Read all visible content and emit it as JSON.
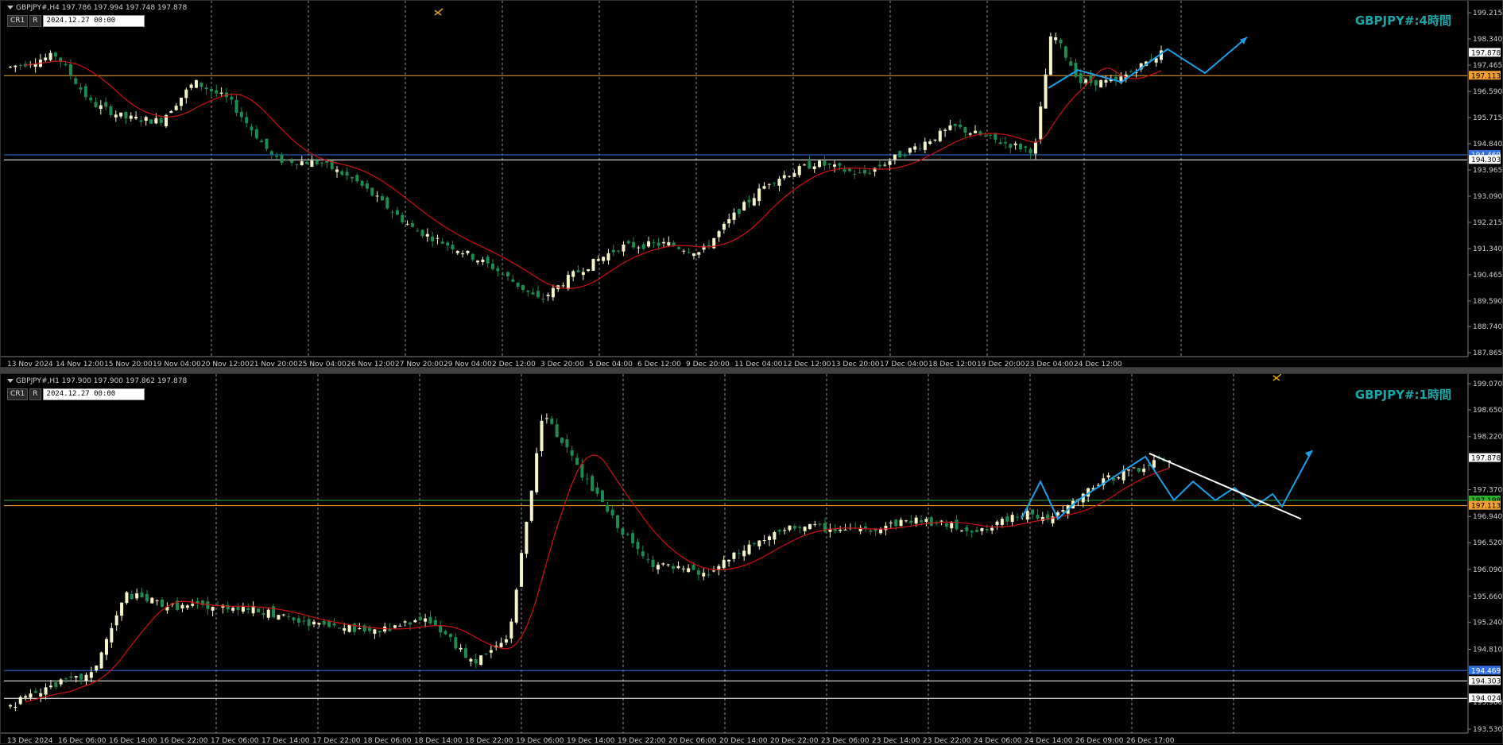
{
  "colors": {
    "background": "#000000",
    "bull": "#f5f5c8",
    "bear": "#1e8c50",
    "ma": "#d01010",
    "grid": "#909090",
    "title": "#1aa6a6",
    "projection": "#19a0e6",
    "trendline": "#ffffff",
    "orange_line": "#f0a030",
    "blue_line": "#3070e0",
    "green_line": "#30b030",
    "white_line": "#ffffff"
  },
  "pane_h4": {
    "header_text": "GBPJPY#,H4  197.786 197.994 197.748 197.878",
    "tb_cr": "CR1",
    "tb_r": "R",
    "date_box": "2024.12.27 00:00",
    "title": "GBPJPY#:4時間",
    "price_labels": [
      {
        "text": "199.215",
        "v": 199.215
      },
      {
        "text": "198.340",
        "v": 198.34
      },
      {
        "text": "197.465",
        "v": 197.465
      },
      {
        "text": "196.590",
        "v": 196.59
      },
      {
        "text": "195.715",
        "v": 195.715
      },
      {
        "text": "194.840",
        "v": 194.84
      },
      {
        "text": "193.965",
        "v": 193.965
      },
      {
        "text": "193.090",
        "v": 193.09
      },
      {
        "text": "192.215",
        "v": 192.215
      },
      {
        "text": "191.340",
        "v": 191.34
      },
      {
        "text": "190.465",
        "v": 190.465
      },
      {
        "text": "189.590",
        "v": 189.59
      },
      {
        "text": "188.740",
        "v": 188.74
      },
      {
        "text": "187.865",
        "v": 187.865
      }
    ],
    "special_labels": [
      {
        "text": "197.878",
        "v": 197.878,
        "bg": "#ffffff",
        "fg": "#000000"
      },
      {
        "text": "197.113",
        "v": 197.113,
        "bg": "#f0a030",
        "fg": "#000000"
      },
      {
        "text": "194.469",
        "v": 194.469,
        "bg": "#3070e0",
        "fg": "#ffffff"
      },
      {
        "text": "194.303",
        "v": 194.303,
        "bg": "#ffffff",
        "fg": "#000000"
      }
    ],
    "time_labels": [
      "13 Nov 2024",
      "14 Nov 12:00",
      "15 Nov 20:00",
      "19 Nov 04:00",
      "20 Nov 12:00",
      "21 Nov 20:00",
      "25 Nov 04:00",
      "26 Nov 12:00",
      "27 Nov 20:00",
      "29 Nov 04:00",
      "2 Dec 12:00",
      "3 Dec 20:00",
      "5 Dec 04:00",
      "6 Dec 12:00",
      "9 Dec 20:00",
      "11 Dec 04:00",
      "12 Dec 12:00",
      "13 Dec 20:00",
      "17 Dec 04:00",
      "18 Dec 12:00",
      "19 Dec 20:00",
      "23 Dec 04:00",
      "24 Dec 12:00"
    ]
  },
  "pane_h1": {
    "header_text": "GBPJPY#,H1  197.900 197.900 197.862 197.878",
    "tb_cr": "CR1",
    "tb_r": "R",
    "date_box": "2024.12.27 00:00",
    "title": "GBPJPY#:1時間",
    "price_labels": [
      {
        "text": "199.070",
        "v": 199.07
      },
      {
        "text": "198.650",
        "v": 198.65
      },
      {
        "text": "198.220",
        "v": 198.22
      },
      {
        "text": "197.370",
        "v": 197.37
      },
      {
        "text": "196.940",
        "v": 196.94
      },
      {
        "text": "196.520",
        "v": 196.52
      },
      {
        "text": "196.090",
        "v": 196.09
      },
      {
        "text": "195.660",
        "v": 195.66
      },
      {
        "text": "195.240",
        "v": 195.24
      },
      {
        "text": "194.810",
        "v": 194.81
      },
      {
        "text": "193.960",
        "v": 193.96
      },
      {
        "text": "193.530",
        "v": 193.53
      }
    ],
    "special_labels": [
      {
        "text": "197.878",
        "v": 197.878,
        "bg": "#ffffff",
        "fg": "#000000"
      },
      {
        "text": "197.198",
        "v": 197.198,
        "bg": "#30b030",
        "fg": "#000000"
      },
      {
        "text": "197.113",
        "v": 197.113,
        "bg": "#f0a030",
        "fg": "#000000"
      },
      {
        "text": "194.469",
        "v": 194.469,
        "bg": "#3070e0",
        "fg": "#ffffff"
      },
      {
        "text": "194.303",
        "v": 194.303,
        "bg": "#ffffff",
        "fg": "#000000"
      },
      {
        "text": "194.024",
        "v": 194.024,
        "bg": "#ffffff",
        "fg": "#000000"
      }
    ],
    "time_labels": [
      "13 Dec 2024",
      "16 Dec 06:00",
      "16 Dec 14:00",
      "16 Dec 22:00",
      "17 Dec 06:00",
      "17 Dec 14:00",
      "17 Dec 22:00",
      "18 Dec 06:00",
      "18 Dec 14:00",
      "18 Dec 22:00",
      "19 Dec 06:00",
      "19 Dec 14:00",
      "19 Dec 22:00",
      "20 Dec 06:00",
      "20 Dec 14:00",
      "20 Dec 22:00",
      "23 Dec 06:00",
      "23 Dec 14:00",
      "23 Dec 22:00",
      "24 Dec 06:00",
      "24 Dec 14:00",
      "26 Dec 09:00",
      "26 Dec 17:00"
    ]
  }
}
